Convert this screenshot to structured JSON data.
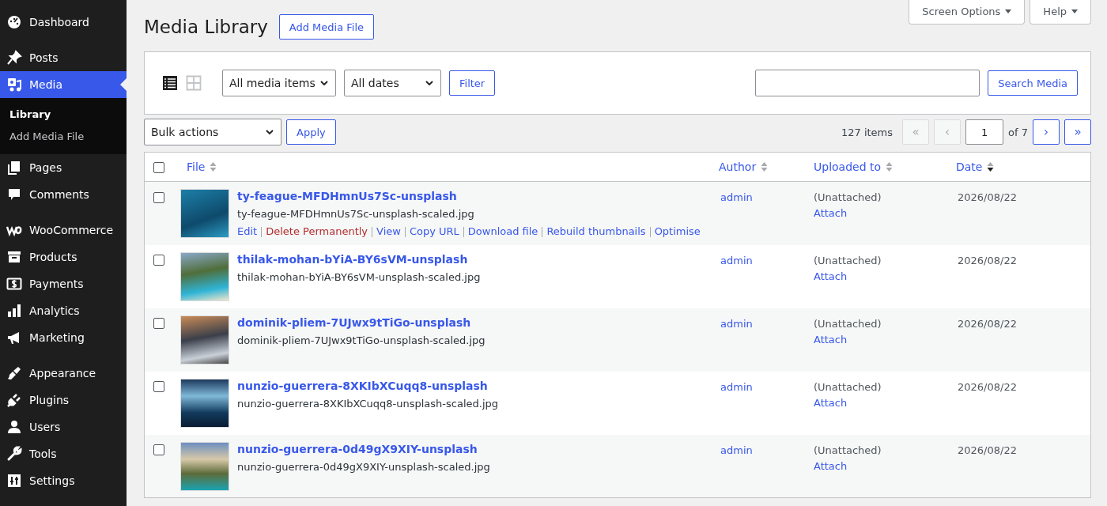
{
  "sidebar": {
    "groups": [
      [
        {
          "label": "Dashboard",
          "selected": false
        }
      ],
      [
        {
          "label": "Posts",
          "selected": false
        },
        {
          "label": "Media",
          "selected": true,
          "children": [
            {
              "label": "Library",
              "selected": true
            },
            {
              "label": "Add Media File",
              "selected": false
            }
          ]
        },
        {
          "label": "Pages",
          "selected": false
        },
        {
          "label": "Comments",
          "selected": false
        }
      ],
      [
        {
          "label": "WooCommerce",
          "selected": false
        },
        {
          "label": "Products",
          "selected": false
        },
        {
          "label": "Payments",
          "selected": false
        },
        {
          "label": "Analytics",
          "selected": false
        },
        {
          "label": "Marketing",
          "selected": false
        }
      ],
      [
        {
          "label": "Appearance",
          "selected": false
        },
        {
          "label": "Plugins",
          "selected": false
        },
        {
          "label": "Users",
          "selected": false
        },
        {
          "label": "Tools",
          "selected": false
        },
        {
          "label": "Settings",
          "selected": false
        }
      ]
    ]
  },
  "screen_meta": [
    "Screen Options",
    "Help"
  ],
  "page_title": "Media Library",
  "add_button": "Add Media File",
  "views": [
    {
      "kind": "list",
      "selected": true
    },
    {
      "kind": "grid",
      "selected": false
    }
  ],
  "filters": {
    "type_select": "All media items",
    "date_select": "All dates",
    "filter_button": "Filter",
    "search_button": "Search Media"
  },
  "bulk": {
    "select": "Bulk actions",
    "apply": "Apply"
  },
  "pagination": {
    "count": "127 items",
    "first": {
      "label": "«",
      "disabled": true
    },
    "prev": {
      "label": "‹",
      "disabled": true
    },
    "page": "1",
    "of": "of 7",
    "next": {
      "label": "›",
      "disabled": false
    },
    "last": {
      "label": "»",
      "disabled": false
    }
  },
  "table": {
    "select_all": {
      "checked": false
    },
    "columns": [
      {
        "label": "File",
        "sorted": false
      },
      {
        "label": "Author",
        "sorted": false
      },
      {
        "label": "Uploaded to",
        "sorted": false
      },
      {
        "label": "Date",
        "sorted": true
      }
    ],
    "rows": [
      {
        "title": "ty-feague-MFDHmnUs7Sc-unsplash",
        "filename": "ty-feague-MFDHmnUs7Sc-unsplash-scaled.jpg",
        "checked": false,
        "author": "admin",
        "uploaded_to": "(Unattached)",
        "attach": "Attach",
        "date": "2026/08/22",
        "actions": [
          {
            "label": "Edit",
            "kind": "link"
          },
          {
            "label": "Delete Permanently",
            "kind": "delete"
          },
          {
            "label": "View",
            "kind": "link"
          },
          {
            "label": "Copy URL",
            "kind": "link"
          },
          {
            "label": "Download file",
            "kind": "link"
          },
          {
            "label": "Rebuild thumbnails",
            "kind": "link"
          },
          {
            "label": "Optimise",
            "kind": "link"
          }
        ]
      },
      {
        "title": "thilak-mohan-bYiA-BY6sVM-unsplash",
        "filename": "thilak-mohan-bYiA-BY6sVM-unsplash-scaled.jpg",
        "checked": false,
        "author": "admin",
        "uploaded_to": "(Unattached)",
        "attach": "Attach",
        "date": "2026/08/22"
      },
      {
        "title": "dominik-pliem-7UJwx9tTiGo-unsplash",
        "filename": "dominik-pliem-7UJwx9tTiGo-unsplash-scaled.jpg",
        "checked": false,
        "author": "admin",
        "uploaded_to": "(Unattached)",
        "attach": "Attach",
        "date": "2026/08/22"
      },
      {
        "title": "nunzio-guerrera-8XKIbXCuqq8-unsplash",
        "filename": "nunzio-guerrera-8XKIbXCuqq8-unsplash-scaled.jpg",
        "checked": false,
        "author": "admin",
        "uploaded_to": "(Unattached)",
        "attach": "Attach",
        "date": "2026/08/22"
      },
      {
        "title": "nunzio-guerrera-0d49gX9XIY-unsplash",
        "filename": "nunzio-guerrera-0d49gX9XIY-unsplash-scaled.jpg",
        "checked": false,
        "author": "admin",
        "uploaded_to": "(Unattached)",
        "attach": "Attach",
        "date": "2026/08/22"
      }
    ]
  }
}
